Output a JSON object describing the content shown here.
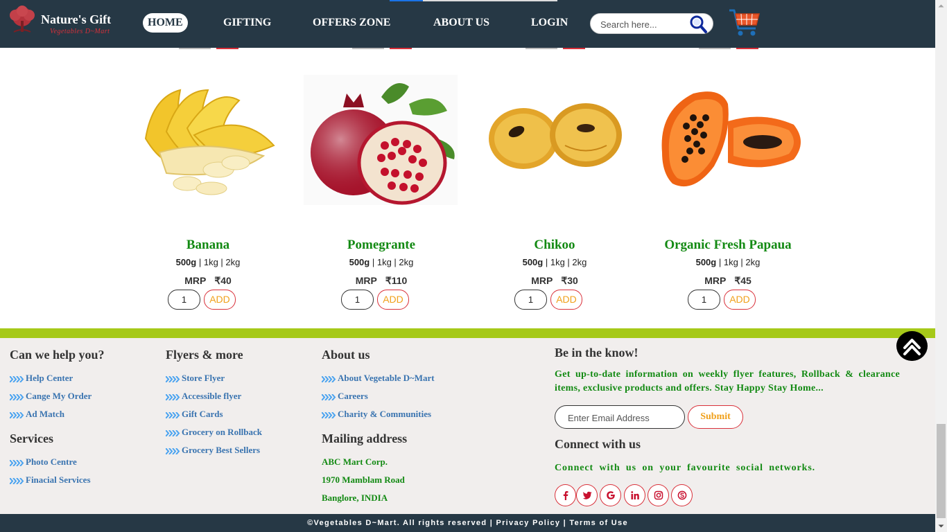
{
  "header": {
    "logo_title": "Nature's Gift",
    "logo_subtitle": "Vegetables D~Mart",
    "nav": [
      {
        "label": "HOME",
        "active": true
      },
      {
        "label": "GIFTING",
        "active": false
      },
      {
        "label": "OFFERS ZONE",
        "active": false
      },
      {
        "label": "ABOUT US",
        "active": false
      },
      {
        "label": "LOGIN",
        "active": false
      }
    ],
    "search_placeholder": "Search here...",
    "search_icon": "magnifier-icon",
    "cart_icon": "shopping-cart-icon"
  },
  "products": [
    {
      "name": "Banana",
      "sizes": [
        "500g",
        "1kg",
        "2kg"
      ],
      "mrp_label": "MRP",
      "price": "₹40",
      "qty": "1",
      "add_label": "ADD"
    },
    {
      "name": "Pomegrante",
      "sizes": [
        "500g",
        "1kg",
        "2kg"
      ],
      "mrp_label": "MRP",
      "price": "₹110",
      "qty": "1",
      "add_label": "ADD"
    },
    {
      "name": "Chikoo",
      "sizes": [
        "500g",
        "1kg",
        "2kg"
      ],
      "mrp_label": "MRP",
      "price": "₹30",
      "qty": "1",
      "add_label": "ADD"
    },
    {
      "name": "Organic Fresh Papaua",
      "sizes": [
        "500g",
        "1kg",
        "2kg"
      ],
      "mrp_label": "MRP",
      "price": "₹45",
      "qty": "1",
      "add_label": "ADD"
    }
  ],
  "footer": {
    "help": {
      "title": "Can we help you?",
      "links": [
        "Help Center",
        "Cange My Order",
        "Ad Match"
      ]
    },
    "services": {
      "title": "Services",
      "links": [
        "Photo Centre",
        "Finacial Services"
      ]
    },
    "flyers": {
      "title": "Flyers & more",
      "links": [
        "Store Flyer",
        "Accessible flyer",
        "Gift Cards",
        "Grocery on Rollback",
        "Grocery Best Sellers"
      ]
    },
    "about": {
      "title": "About us",
      "links": [
        "About Vegetable D~Mart",
        "Careers",
        "Charity & Communities"
      ]
    },
    "mailing": {
      "title": "Mailing address",
      "lines": [
        "ABC Mart Corp.",
        "1970 Mamblam Road",
        "Banglore, INDIA"
      ]
    },
    "know": {
      "title": "Be in the know!",
      "text": "Get up-to-date information on weekly flyer features, Rollback & clearance items, exclusive products and offers. Stay Happy Stay Home...",
      "email_placeholder": "Enter Email Address",
      "submit_label": "Submit"
    },
    "connect": {
      "title": "Connect with us",
      "text": "Connect with us on your favourite social networks.",
      "icons": [
        "facebook-icon",
        "twitter-icon",
        "google-icon",
        "linkedin-icon",
        "instagram-icon",
        "skype-icon"
      ]
    }
  },
  "copyright": {
    "text": "©Vegetables D~Mart. All rights reserved",
    "sep": "|",
    "privacy": "Privacy Policy",
    "terms": "Terms of Use"
  },
  "colors": {
    "header_bg": "#263845",
    "product_name": "#138a13",
    "footer_link": "#3a74b0",
    "accent_red": "#d9303a",
    "accent_orange": "#f0a01a",
    "green_strip": "#a6c919",
    "footer_bg": "#f1eeed"
  }
}
